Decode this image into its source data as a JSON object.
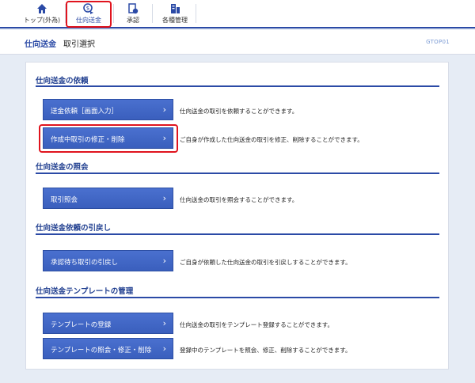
{
  "nav": {
    "items": [
      {
        "label": "トップ(外為)",
        "icon": "home-icon"
      },
      {
        "label": "仕向送金",
        "icon": "remittance-icon"
      },
      {
        "label": "承認",
        "icon": "approval-icon"
      },
      {
        "label": "各種管理",
        "icon": "management-icon"
      }
    ]
  },
  "header": {
    "section": "仕向送金",
    "subtitle": "取引選択",
    "screen_code": "GTOP01"
  },
  "sections": [
    {
      "title": "仕向送金の依頼",
      "buttons": [
        {
          "label": "送金依頼［画面入力］",
          "description": "仕向送金の取引を依頼することができます。"
        },
        {
          "label": "作成中取引の修正・削除",
          "description": "ご自身が作成した仕向送金の取引を修正、削除することができます。"
        }
      ]
    },
    {
      "title": "仕向送金の照会",
      "buttons": [
        {
          "label": "取引照会",
          "description": "仕向送金の取引を照会することができます。"
        }
      ]
    },
    {
      "title": "仕向送金依頼の引戻し",
      "buttons": [
        {
          "label": "承認待ち取引の引戻し",
          "description": "ご自身が依頼した仕向送金の取引を引戻しすることができます。"
        }
      ]
    },
    {
      "title": "仕向送金テンプレートの管理",
      "buttons": [
        {
          "label": "テンプレートの登録",
          "description": "仕向送金の取引をテンプレート登録することができます。"
        },
        {
          "label": "テンプレートの照会・修正・削除",
          "description": "登録中のテンプレートを照会、修正、削除することができます。"
        }
      ]
    }
  ],
  "chevron": "›",
  "colors": {
    "accent": "#2b4aa6",
    "button": "#3f65c5",
    "highlight": "#e0141e"
  }
}
